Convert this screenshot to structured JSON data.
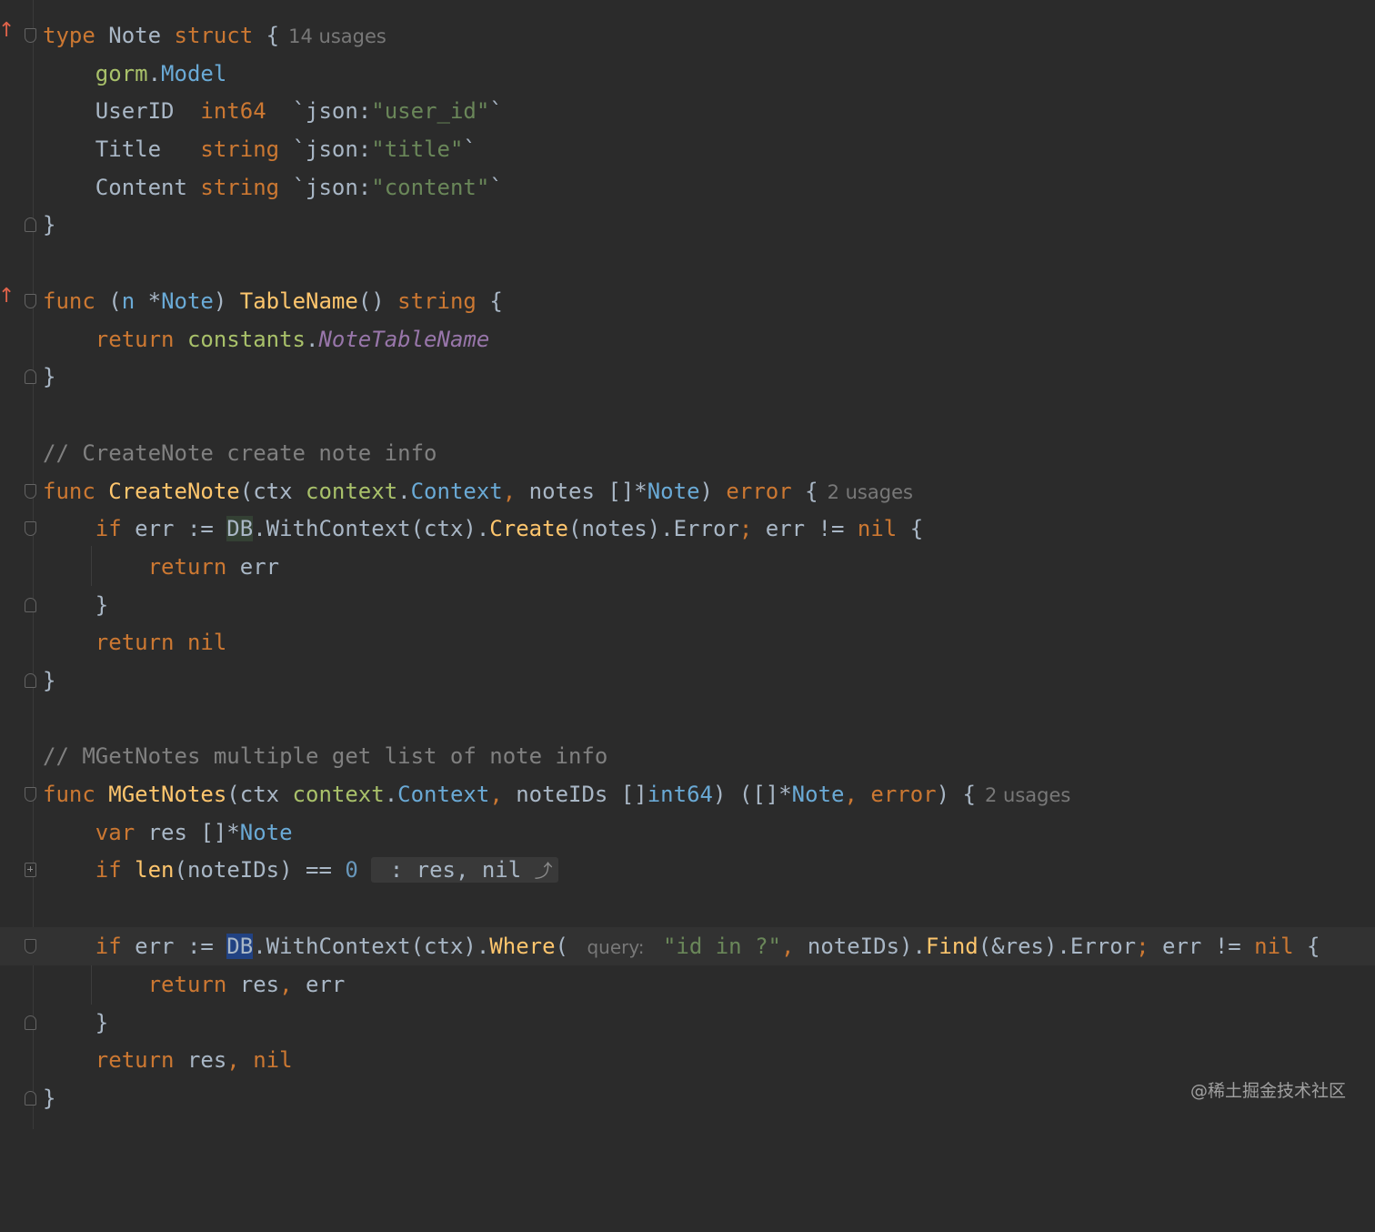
{
  "editor": {
    "lines": {
      "l1": {
        "kw_type": "type",
        "name": "Note",
        "kw_struct": "struct",
        "brace": "{",
        "usages": "14 usages"
      },
      "l2": {
        "pkg": "gorm",
        "dot": ".",
        "ext": "Model"
      },
      "l3": {
        "field": "UserID",
        "type": "int64",
        "tag_open": "`json:",
        "tag_val": "\"user_id\"",
        "tag_close": "`"
      },
      "l4": {
        "field": "Title",
        "type": "string",
        "tag_open": "`json:",
        "tag_val": "\"title\"",
        "tag_close": "`"
      },
      "l5": {
        "field": "Content",
        "type": "string",
        "tag_open": "`json:",
        "tag_val": "\"content\"",
        "tag_close": "`"
      },
      "l6": {
        "brace": "}"
      },
      "l8": {
        "kw_func": "func",
        "recv_open": "(",
        "recv_var": "n",
        "star": "*",
        "recv_type": "Note",
        "recv_close": ")",
        "fn": "TableName",
        "parens": "()",
        "ret": "string",
        "brace": "{"
      },
      "l9": {
        "kw_return": "return",
        "pkg": "constants",
        "dot": ".",
        "const": "NoteTableName"
      },
      "l10": {
        "brace": "}"
      },
      "l12": {
        "comment": "// CreateNote create note info"
      },
      "l13": {
        "kw_func": "func",
        "fn": "CreateNote",
        "p1": "(ctx ",
        "pkg": "context",
        "dot": ".",
        "ext": "Context",
        "comma": ",",
        "p2": " notes []*",
        "type": "Note",
        "p3": ") ",
        "ret": "error",
        "brace": " {",
        "usages": "2 usages"
      },
      "l14": {
        "kw_if": "if",
        "p1": " err := ",
        "db": "DB",
        "p2": ".WithContext(ctx).",
        "create": "Create",
        "p3": "(notes).Error",
        "semi": ";",
        "p4": " err != ",
        "nil": "nil",
        "brace": " {"
      },
      "l15": {
        "kw_return": "return",
        "rest": " err"
      },
      "l16": {
        "brace": "}"
      },
      "l17": {
        "kw_return": "return",
        "nil": "nil"
      },
      "l18": {
        "brace": "}"
      },
      "l20": {
        "comment": "// MGetNotes multiple get list of note info"
      },
      "l21": {
        "kw_func": "func",
        "fn": "MGetNotes",
        "p1": "(ctx ",
        "pkg": "context",
        "dot": ".",
        "ext": "Context",
        "comma": ",",
        "p2": " noteIDs []",
        "int": "int64",
        "p3": ") ([]*",
        "type": "Note",
        "comma2": ",",
        "ret": "error",
        "p4": ") {",
        "usages": "2 usages"
      },
      "l22": {
        "kw_var": "var",
        "p1": " res []*",
        "type": "Note"
      },
      "l23": {
        "kw_if": "if",
        "len": "len",
        "p1": "(noteIDs) == ",
        "num": "0",
        "fold": " : res, nil ",
        "fold_icon": "⤴"
      },
      "l25": {
        "kw_if": "if",
        "p1": " err := ",
        "db": "DB",
        "p2": ".WithContext(ctx).",
        "where": "Where",
        "p3": "( ",
        "hint": "query:",
        "str": "\"id in ?\"",
        "comma": ",",
        "p4": " noteIDs).",
        "find": "Find",
        "p5": "(&res).Error",
        "semi": ";",
        "p6": " err != ",
        "nil": "nil",
        "brace": " {"
      },
      "l26": {
        "kw_return": "return",
        "p1": " res",
        "comma": ",",
        "p2": " err"
      },
      "l27": {
        "brace": "}"
      },
      "l28": {
        "kw_return": "return",
        "p1": " res",
        "comma": ",",
        "nil": "nil"
      },
      "l29": {
        "brace": "}"
      }
    }
  },
  "watermark": "@稀土掘金技术社区"
}
